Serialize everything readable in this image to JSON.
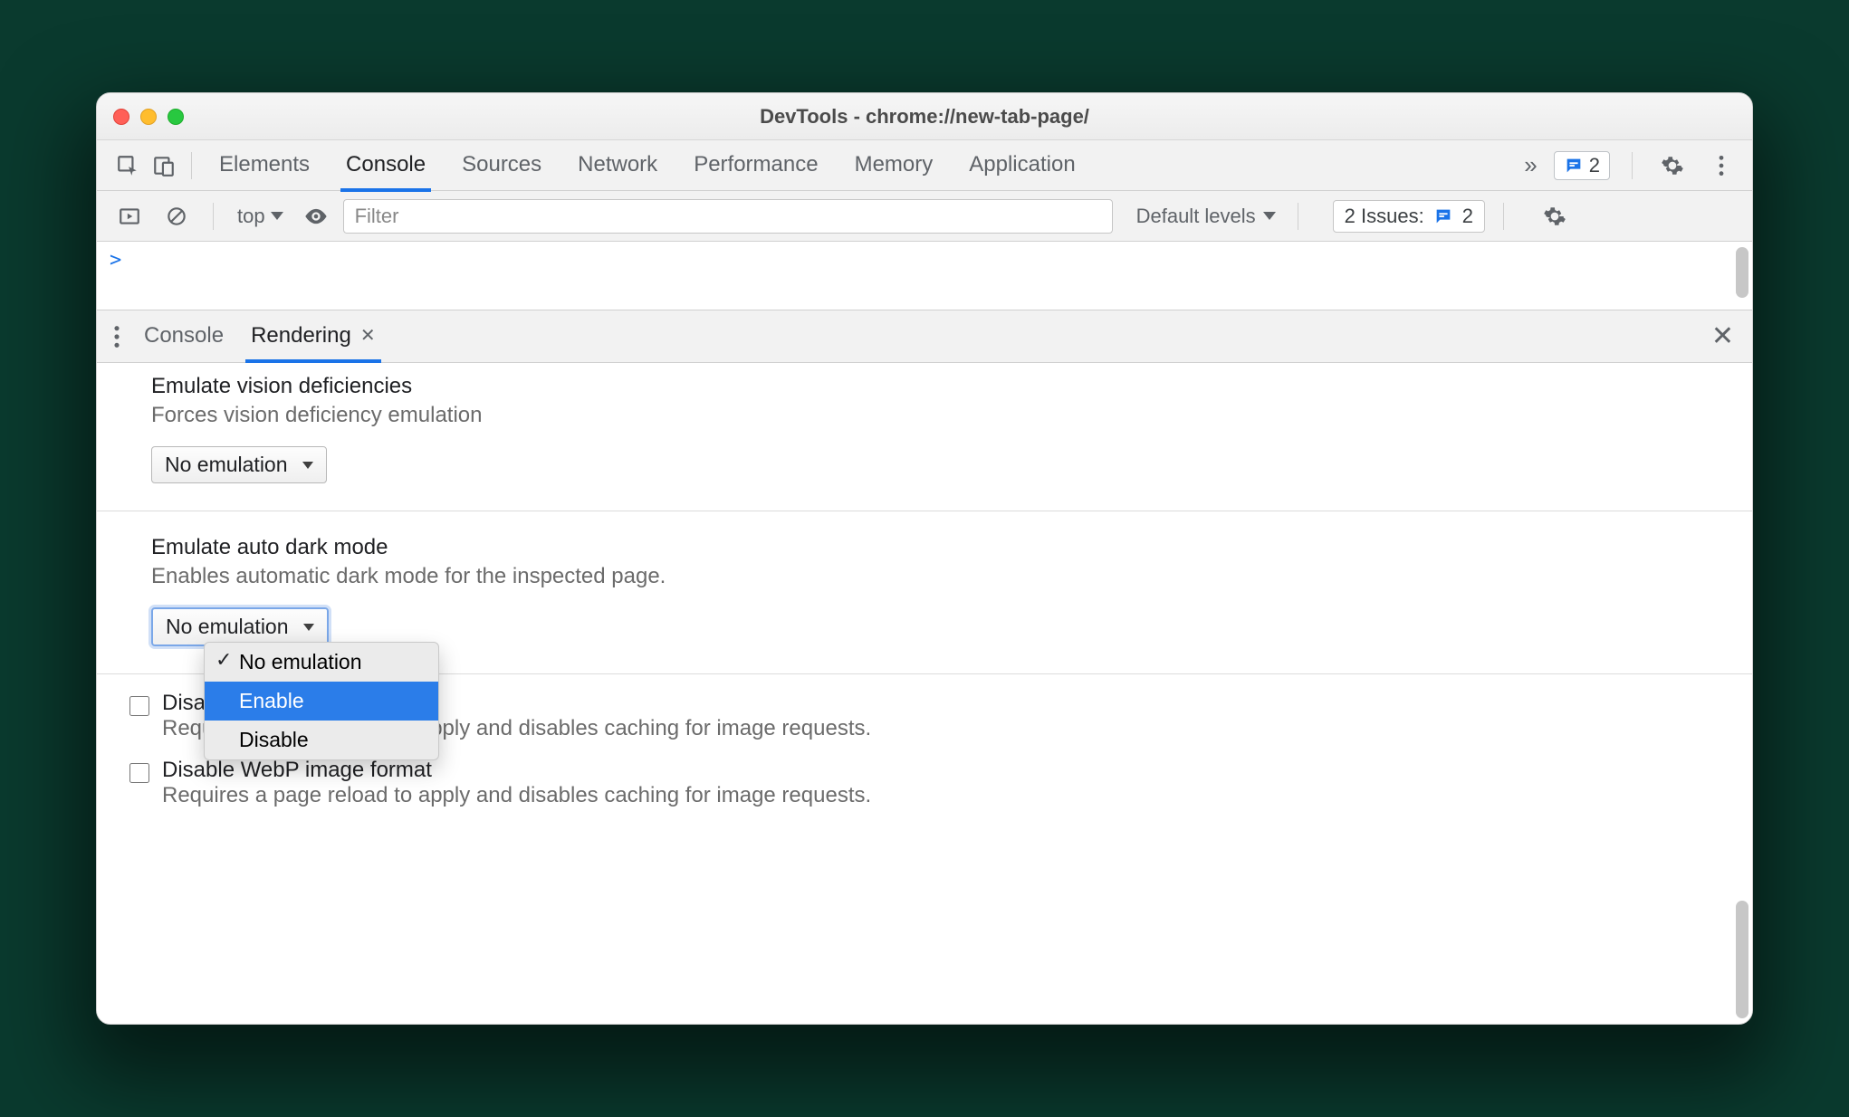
{
  "window": {
    "title": "DevTools - chrome://new-tab-page/"
  },
  "tabbar": {
    "tabs": [
      "Elements",
      "Console",
      "Sources",
      "Network",
      "Performance",
      "Memory",
      "Application"
    ],
    "activeIndex": 1,
    "messages_badge": "2"
  },
  "console_ctrls": {
    "context": "top",
    "filter_placeholder": "Filter",
    "levels_label": "Default levels",
    "issues_label": "2 Issues:",
    "issues_count": "2"
  },
  "console_prompt": ">",
  "drawer": {
    "tabs": [
      "Console",
      "Rendering"
    ],
    "activeIndex": 1
  },
  "rendering": {
    "vision": {
      "title": "Emulate vision deficiencies",
      "desc": "Forces vision deficiency emulation",
      "select_value": "No emulation"
    },
    "auto_dark": {
      "title": "Emulate auto dark mode",
      "desc": "Enables automatic dark mode for the inspected page.",
      "select_value": "No emulation",
      "options": [
        {
          "label": "No emulation",
          "checked": true,
          "hover": false
        },
        {
          "label": "Enable",
          "checked": false,
          "hover": true
        },
        {
          "label": "Disable",
          "checked": false,
          "hover": false
        }
      ]
    },
    "avif": {
      "title": "Disable AVIF image format",
      "desc": "Requires a page reload to apply and disables caching for image requests."
    },
    "webp": {
      "title": "Disable WebP image format",
      "desc": "Requires a page reload to apply and disables caching for image requests."
    }
  }
}
